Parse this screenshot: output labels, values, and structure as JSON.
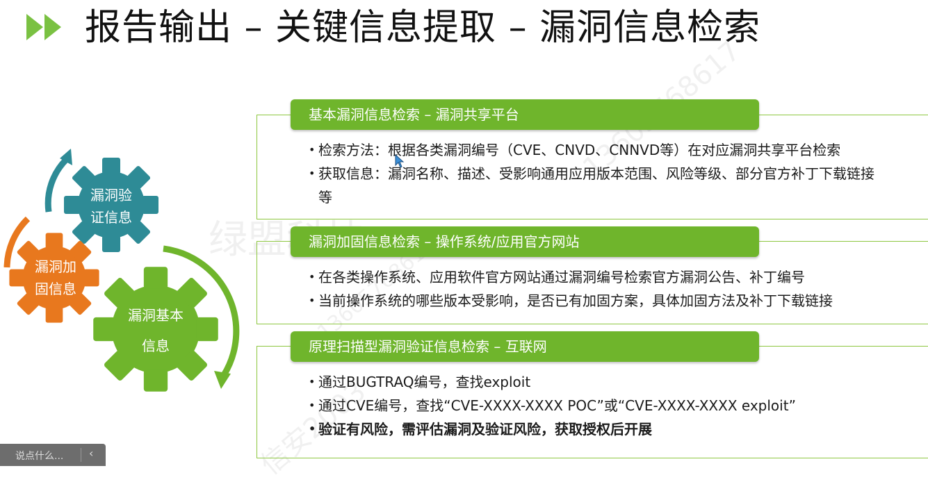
{
  "title": "报告输出 – 关键信息提取 – 漏洞信息检索",
  "watermarks": [
    "绿盟科技",
    "13605768617",
    "信安2003",
    "13605768617"
  ],
  "colors": {
    "accent_green": "#6fb52c",
    "gear_teal": "#2e8b96",
    "gear_orange": "#e8781e",
    "gear_green": "#6fb52c"
  },
  "gears": {
    "verify": "漏洞验\n证信息",
    "harden": "漏洞加\n固信息",
    "basic": "漏洞基本\n信息"
  },
  "sections": [
    {
      "header": "基本漏洞信息检索 – 漏洞共享平台",
      "bullets": [
        "检索方法：根据各类漏洞编号（CVE、CNVD、CNNVD等）在对应漏洞共享平台检索",
        "获取信息：漏洞名称、描述、受影响通用应用版本范围、风险等级、部分官方补丁下载链接等"
      ]
    },
    {
      "header": "漏洞加固信息检索 – 操作系统/应用官方网站",
      "bullets": [
        "在各类操作系统、应用软件官方网站通过漏洞编号检索官方漏洞公告、补丁编号",
        "当前操作系统的哪些版本受影响，是否已有加固方案，具体加固方法及补丁下载链接"
      ]
    },
    {
      "header": "原理扫描型漏洞验证信息检索 – 互联网",
      "bullets": [
        "通过BUGTRAQ编号，查找exploit",
        "通过CVE编号，查找“CVE-XXXX-XXXX POC”或“CVE-XXXX-XXXX exploit”",
        "验证有风险，需评估漏洞及验证风险，获取授权后开展"
      ]
    }
  ],
  "toolbar": {
    "chat_placeholder": "说点什么...",
    "collapse_icon": "chevron-left-icon"
  }
}
